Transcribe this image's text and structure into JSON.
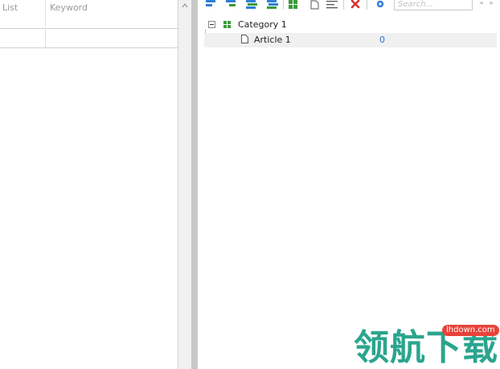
{
  "left_pane": {
    "columns": [
      "List",
      "Keyword"
    ]
  },
  "toolbar": {
    "icons": [
      "indent-left-icon",
      "indent-right-icon",
      "stack-up-icon",
      "stack-down-icon",
      "grid-icon",
      "new-doc-icon",
      "align-icon",
      "delete-icon",
      "settings-icon"
    ],
    "search_placeholder": "Search...",
    "colors": {
      "blue": "#2f7fd6",
      "green": "#3a9a3a",
      "red": "#d9322e"
    }
  },
  "tree": {
    "category": {
      "label": "Category 1"
    },
    "article": {
      "label": "Article 1",
      "count": "0"
    }
  },
  "watermark": {
    "text": "领航下载",
    "badge": "lhdown.com",
    "color": "#2aa58d",
    "badge_color": "#e8423a"
  }
}
